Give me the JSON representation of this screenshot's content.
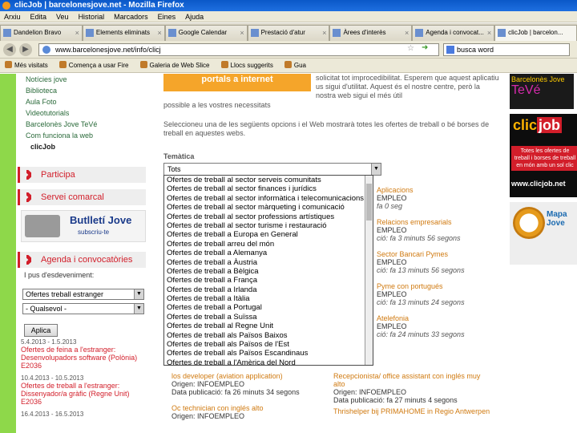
{
  "window": {
    "title": "clicJob | barcelonesjove.net - Mozilla Firefox"
  },
  "menu": [
    "Arxiu",
    "Edita",
    "Veu",
    "Historial",
    "Marcadors",
    "Eines",
    "Ajuda"
  ],
  "tabs": [
    {
      "label": "Dandelion Bravo"
    },
    {
      "label": "Elements eliminats"
    },
    {
      "label": "Google Calendar"
    },
    {
      "label": "Prestació d'atur"
    },
    {
      "label": "Àrees d'interès"
    },
    {
      "label": "Agenda i convocat..."
    },
    {
      "label": "clicJob | barcelon..."
    }
  ],
  "nav": {
    "url": "www.barcelonesjove.net/info/clicj",
    "search_text": "busca word"
  },
  "bookmarks": [
    "Més visitats",
    "Comença a usar Fire",
    "Galeria de Web Slice",
    "Llocs suggerits",
    "Gua"
  ],
  "leftnav": {
    "links": [
      "Notícies jove",
      "Biblioteca",
      "Aula Foto",
      "Videotutorials",
      "Barcelonès Jove TeVé",
      "Com funciona la web"
    ],
    "active": "clicJob"
  },
  "sections": {
    "participa": "Participa",
    "serveis": "Servei comarcal",
    "agenda": "Agenda i convocatòries"
  },
  "butlleti": {
    "title": "Butlletí Jove",
    "subtitle": "subscriu-te"
  },
  "agenda": {
    "label": "I pus d'esdeveniment:",
    "select1": "Ofertes treball estranger",
    "select2": "- Qualsevol -",
    "apply_label": "Aplica"
  },
  "events": [
    {
      "date": "5.4.2013 - 1.5.2013",
      "title": "Ofertes de feina a l'estranger: Desenvolupadors software (Polònia) E2036"
    },
    {
      "date": "10.4.2013 - 10.5.2013",
      "title": "Ofertes de treball a l'estranger: Dissenyador/a gràfic (Regne Unit) E2036"
    },
    {
      "date": "16.4.2013 - 16.5.2013",
      "title": ""
    }
  ],
  "main": {
    "banner": "portals a internet",
    "intro": "solicitat tot improcedibilitat. Esperem que aquest aplicatiu us sigui d'utilitat. Aquest és el nostre centre, però la nostra web sigui el més útil",
    "intro2": "possible a les vostres necessitats",
    "intro3": "Seleccioneu una de les següents opcions i el Web mostrarà totes les ofertes de treball o bé borses de treball en aquestes webs.",
    "tematica_label": "Temàtica",
    "dropdown_value": "Tots",
    "list_options": [
      "Ofertes de treball al sector serveis comunitats",
      "Ofertes de treball al sector finances i jurídics",
      "Ofertes de treball al sector informàtica i telecomunicacions",
      "Ofertes de treball al sector màrqueting i comunicació",
      "Ofertes de treball al sector professions artístiques",
      "Ofertes de treball al sector turisme i restauració",
      "Ofertes de treball a Europa en General",
      "Ofertes de treball arreu del món",
      "Ofertes de treball a Alemanya",
      "Ofertes de treball a Àustria",
      "Ofertes de treball a Bèlgica",
      "Ofertes de treball a França",
      "Ofertes de treball a Irlanda",
      "Ofertes de treball a Itàlia",
      "Ofertes de treball a Portugal",
      "Ofertes de treball a Suïssa",
      "Ofertes de treball al Regne Unit",
      "Ofertes de treball als Països Baixos",
      "Ofertes de treball als Països de l'Est",
      "Ofertes de treball als Països Escandinaus",
      "Ofertes de treball a l'Amèrica del Nord"
    ],
    "offers_right": [
      {
        "title": "Aplicacions",
        "origin": "EMPLEO",
        "time": "fa 0 seg"
      },
      {
        "title": "Relacions empresarials",
        "origin": "EMPLEO",
        "time": "ció: fa 3 minuts 56 segons"
      },
      {
        "title": "Sector Bancari Pymes",
        "origin": "EMPLEO",
        "time": "ció: fa 13 minuts 56 segons"
      },
      {
        "title": "Pyme con portugués",
        "origin": "EMPLEO",
        "time": "ció: fa 13 minuts 24 segons"
      },
      {
        "title": "Atelefonia",
        "origin": "EMPLEO",
        "time": "ció: fa 24 minuts 33 segons"
      }
    ],
    "offers_bottom": [
      {
        "title": "los developer (aviation application)",
        "origin": "Origen: INFOEMPLEO",
        "time": "Data publicació: fa 26 minuts 34 segons"
      },
      {
        "title": "Oc technician con inglés alto",
        "origin": "Origen: INFOEMPLEO",
        "time": ""
      }
    ],
    "offers_bottom2": [
      {
        "title": "Recepcionista/ office assistant con inglés muy alto",
        "origin": "Origen: INFOEMPLEO",
        "time": "Data publicació: fa 27 minuts 4 segons"
      },
      {
        "title": "Thrishelper bij PRIMAHOME in Regio Antwerpen",
        "origin": "",
        "time": ""
      }
    ]
  },
  "right": {
    "teve_small": "Barcelonès Jove",
    "teve_big": "TeVé",
    "clicjob_logo_a": "clic",
    "clicjob_logo_b": "job",
    "clicjob_sub": "Totes les ofertes de treball i borses de treball en món amb un sol clic",
    "clicjob_url": "www.clicjob.net",
    "mapa": "Mapa Jove"
  },
  "colors": {
    "accent_red": "#d21e2a",
    "green": "#8ed84a",
    "orange": "#f5a52a"
  }
}
